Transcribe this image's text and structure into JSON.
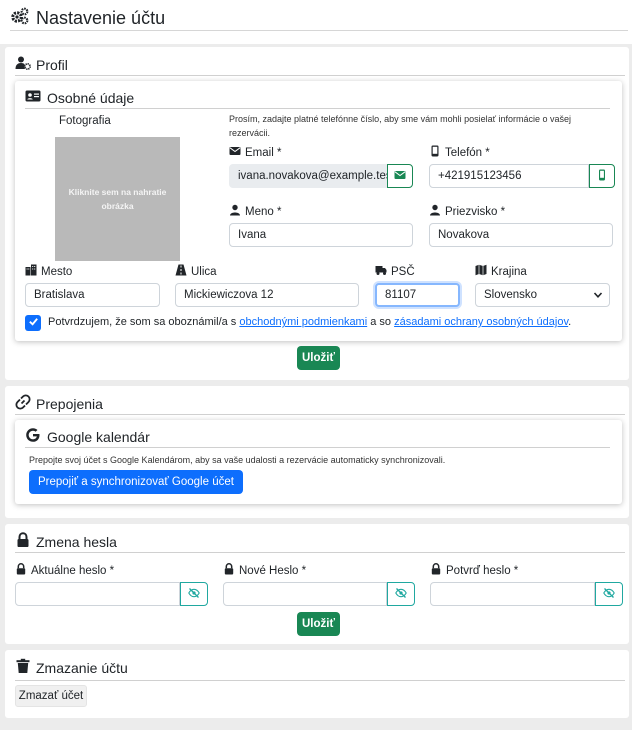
{
  "page": {
    "title": "Nastavenie účtu"
  },
  "profile": {
    "title": "Profil",
    "personal": {
      "title": "Osobné údaje",
      "photo_label": "Fotografia",
      "photo_hint": "Kliknite sem na nahratie obrázka",
      "note": "Prosím, zadajte platné telefónne číslo, aby sme vám mohli posielať informácie o vašej rezervácii.",
      "email": {
        "label": "Email *",
        "value": "ivana.novakova@example.test"
      },
      "phone": {
        "label": "Telefón *",
        "value": "+421915123456"
      },
      "first_name": {
        "label": "Meno *",
        "value": "Ivana"
      },
      "last_name": {
        "label": "Priezvisko *",
        "value": "Novakova"
      },
      "city": {
        "label": "Mesto",
        "value": "Bratislava"
      },
      "street": {
        "label": "Ulica",
        "value": "Mickiewiczova 12"
      },
      "zip": {
        "label": "PSČ",
        "value": "81107"
      },
      "country": {
        "label": "Krajina",
        "value": "Slovensko"
      },
      "consent": {
        "checked": true,
        "prefix": "Potvrdzujem, že som sa oboznámil/a s",
        "link1": "obchodnými podmienkami",
        "middle": "a so",
        "link2": "zásadami ochrany osobných údajov",
        "suffix": "."
      }
    },
    "save_label": "Uložiť"
  },
  "connections": {
    "title": "Prepojenia",
    "google": {
      "title": "Google kalendár",
      "description": "Prepojte svoj účet s Google Kalendárom, aby sa vaše udalosti a rezervácie automaticky synchronizovali.",
      "button": "Prepojiť a synchronizovať Google účet"
    }
  },
  "password": {
    "title": "Zmena hesla",
    "current": {
      "label": "Aktuálne heslo *",
      "value": ""
    },
    "new": {
      "label": "Nové Heslo *",
      "value": ""
    },
    "confirm": {
      "label": "Potvrď heslo *",
      "value": ""
    },
    "save_label": "Uložiť"
  },
  "delete": {
    "title": "Zmazanie účtu",
    "button": "Zmazať účet"
  },
  "colors": {
    "primary": "#0d6efd",
    "success": "#198754",
    "teal": "#20a8a0",
    "photo_bg": "#b9b9b9"
  }
}
